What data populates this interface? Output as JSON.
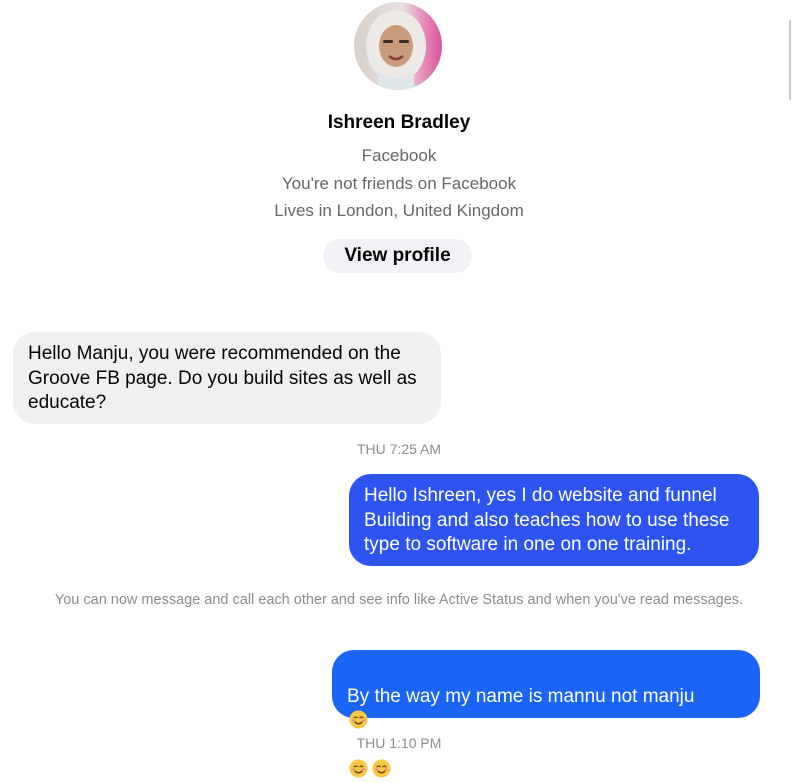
{
  "contact": {
    "name": "Ishreen Bradley",
    "platform": "Facebook",
    "friendship_status": "You're not friends on Facebook",
    "location": "Lives in London, United Kingdom",
    "view_profile_label": "View profile"
  },
  "messages": [
    {
      "direction": "incoming",
      "text": "Hello Manju, you were recommended on the\nGroove FB page. Do you build sites as well as\neducate?"
    },
    {
      "direction": "outgoing",
      "text": "Hello Ishreen, yes I do website and funnel\nBuilding and also teaches how to use these\ntype to software in one on one training."
    },
    {
      "direction": "outgoing",
      "text": "By the way my name is mannu not manju",
      "emoji": "smiling-face-emoji"
    }
  ],
  "timestamps": [
    "THU 7:25 AM",
    "THU 1:10 PM"
  ],
  "system_note": "You can now message and call each other and see info like Active Status and when you've read messages.",
  "colors": {
    "incoming_bubble": "#f0f0f0",
    "outgoing_bubble_1": "#2d53f0",
    "outgoing_bubble_2": "#1a64f8",
    "secondary_text": "#65676b",
    "button_background": "#f0f2f5"
  }
}
